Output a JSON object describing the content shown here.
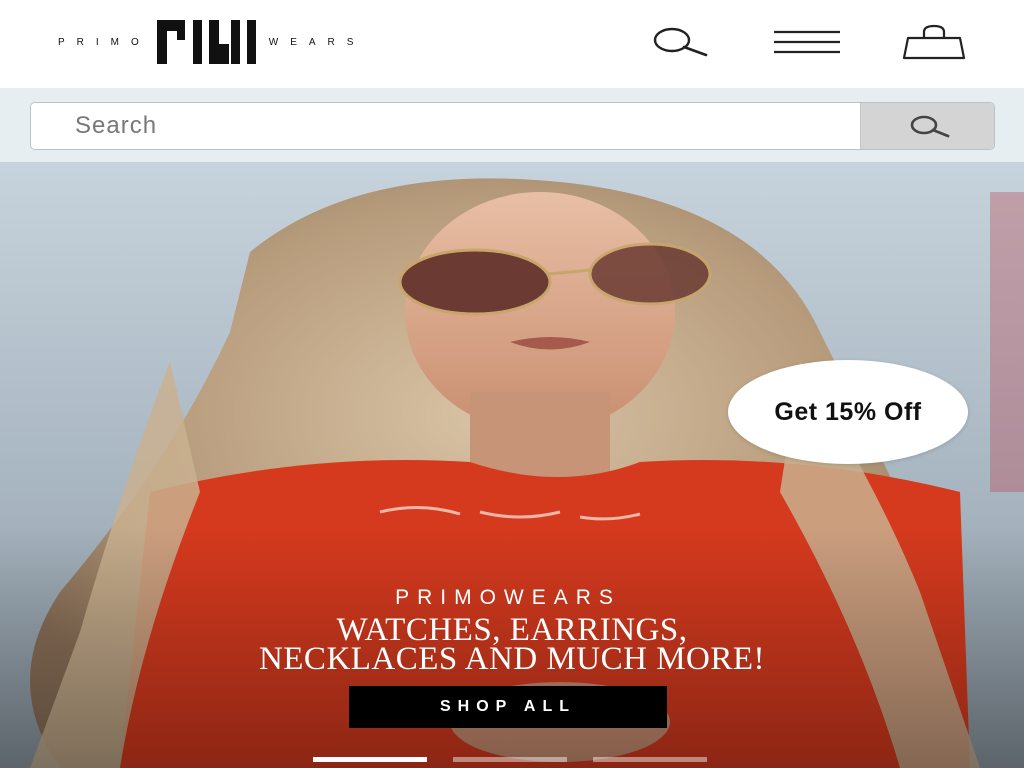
{
  "header": {
    "brand_left": "PRIMO",
    "brand_right": "WEARS",
    "icons": {
      "search": "search-icon",
      "menu": "hamburger-menu-icon",
      "cart": "shopping-bag-icon"
    }
  },
  "search": {
    "placeholder": "Search",
    "button_icon": "search-icon"
  },
  "hero": {
    "promo": "Get 15% Off",
    "eyebrow": "PRIMOWEARS",
    "headline_line1": "WATCHES, EARRINGS,",
    "headline_line2": "NECKLACES AND MUCH MORE!",
    "cta": "SHOP ALL",
    "slides": {
      "count": 3,
      "active_index": 0
    }
  },
  "colors": {
    "header_bg": "#ffffff",
    "search_band_bg": "#e6eef2",
    "search_button_bg": "#d4d4d4",
    "cta_bg": "#000000",
    "cta_text": "#ffffff",
    "hero_shirt": "#d63a1e"
  }
}
